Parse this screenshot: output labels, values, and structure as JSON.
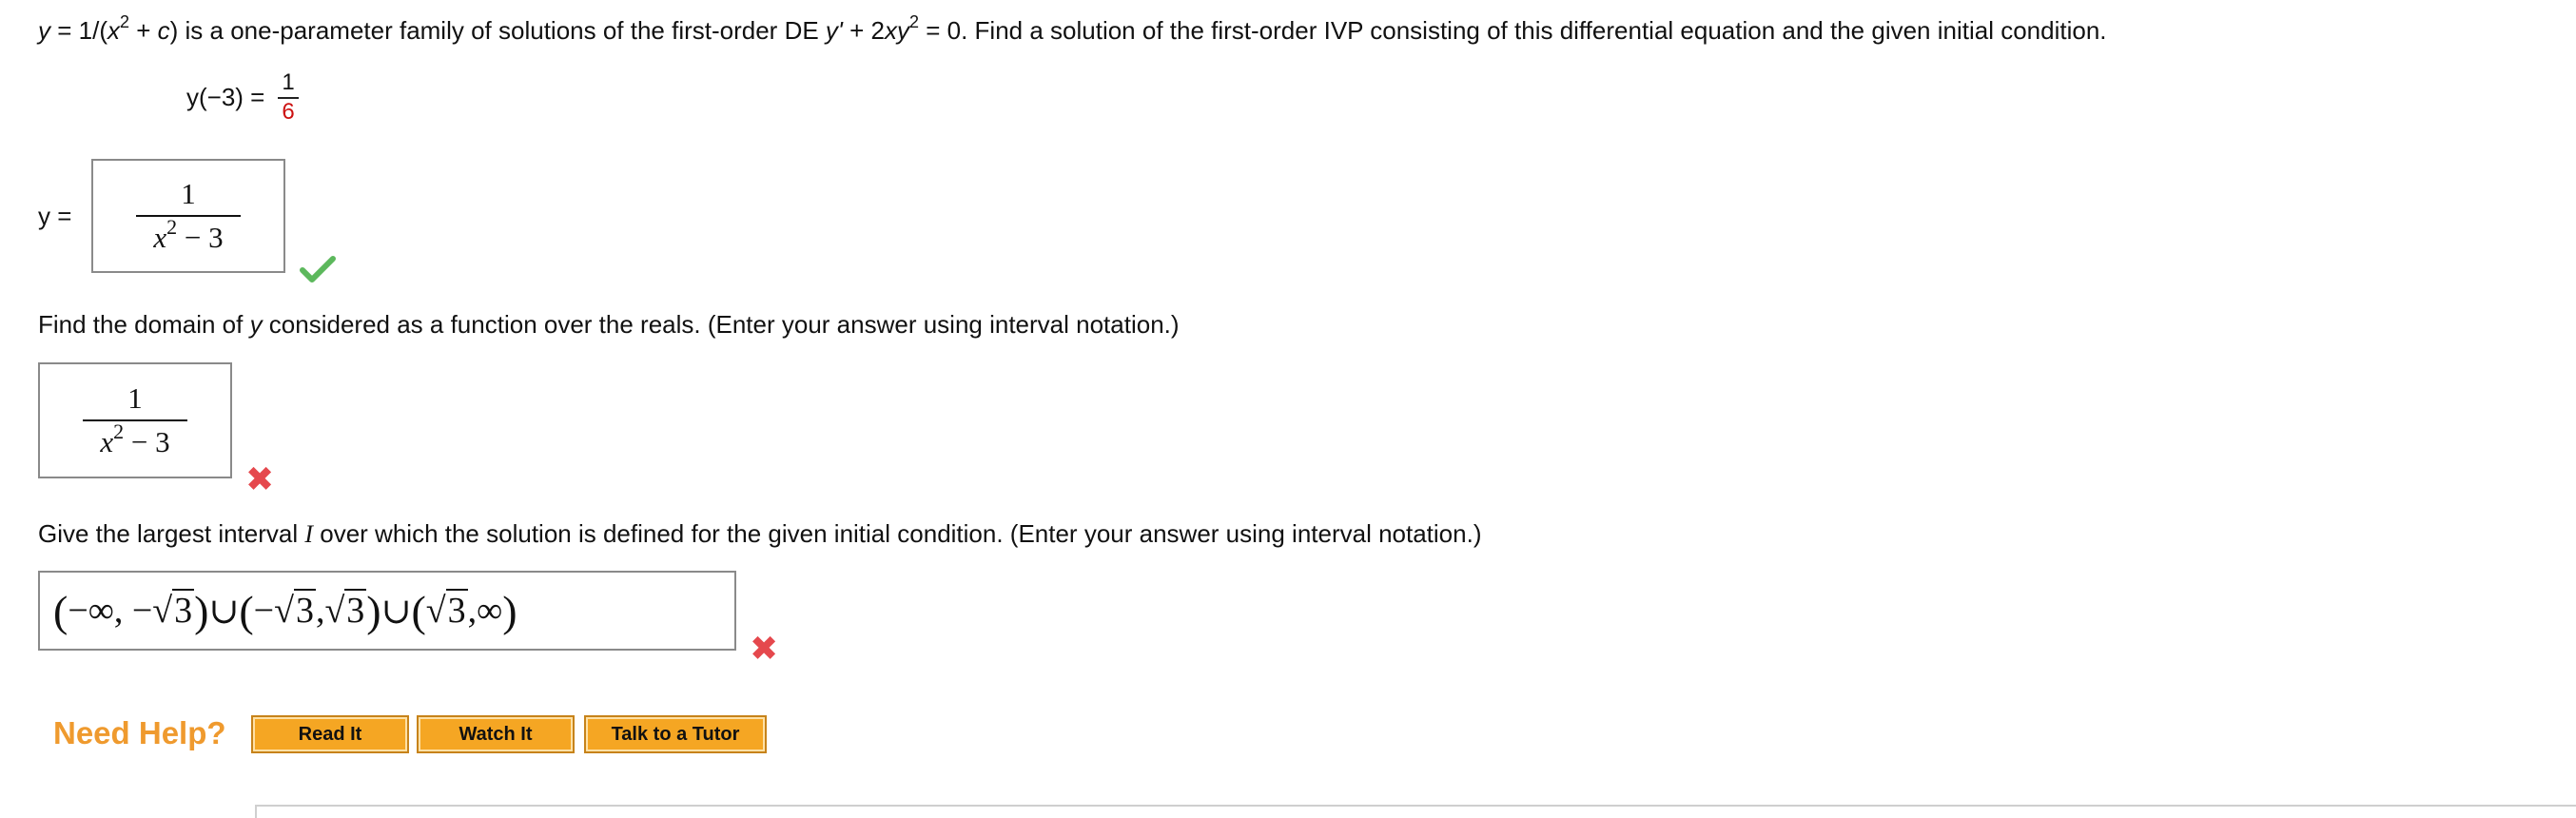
{
  "problem": {
    "statement_parts": {
      "y_var": "y",
      "eq1": " = 1/(",
      "x_var": "x",
      "exp2a": "2",
      "plus_c": " + ",
      "c_var": "c",
      "close": ") is a one-parameter family of solutions of the first-order DE ",
      "yprime": "y'",
      "plus2": " + 2",
      "xy": "xy",
      "exp2b": "2",
      "rest": " = 0. Find a solution of the first-order IVP consisting of this differential equation and the given initial condition."
    },
    "initial_condition": {
      "lhs": "y(−3) =",
      "numerator": "1",
      "denominator": "6"
    }
  },
  "answer1": {
    "label": "y =",
    "numerator": "1",
    "denominator_base": "x",
    "denominator_exp": "2",
    "denominator_rest": " − 3",
    "status": "correct",
    "status_icon": "check-icon",
    "status_color": "#5cb85c"
  },
  "question2": {
    "before": "Find the domain of ",
    "var": "y",
    "after": " considered as a function over the reals. (Enter your answer using interval notation.)"
  },
  "answer2": {
    "numerator": "1",
    "denominator_base": "x",
    "denominator_exp": "2",
    "denominator_rest": " − 3",
    "status": "incorrect",
    "status_icon": "cross-icon",
    "status_color": "#e5484d"
  },
  "question3": {
    "before": "Give the largest interval ",
    "var": "I",
    "after": " over which the solution is defined for the given initial condition. (Enter your answer using interval notation.)"
  },
  "answer3": {
    "p1_open": "(",
    "p1_a": "−∞, − ",
    "p1_sqrt": "3",
    "p1_close": ")",
    "union1": " ∪ ",
    "p2_open": "(",
    "p2_neg": "−",
    "p2_sqrt_a": "3",
    "p2_comma": ",",
    "p2_sqrt_b": "3",
    "p2_close": ")",
    "union2": " ∪ ",
    "p3_open": "(",
    "p3_sqrt": "3",
    "p3_rest": ",∞",
    "p3_close": ")",
    "status": "incorrect",
    "status_icon": "cross-icon",
    "status_color": "#e5484d"
  },
  "help": {
    "label": "Need Help?",
    "buttons": [
      "Read It",
      "Watch It",
      "Talk to a Tutor"
    ],
    "label_color": "#ef9a2e",
    "button_color": "#f5a623"
  }
}
